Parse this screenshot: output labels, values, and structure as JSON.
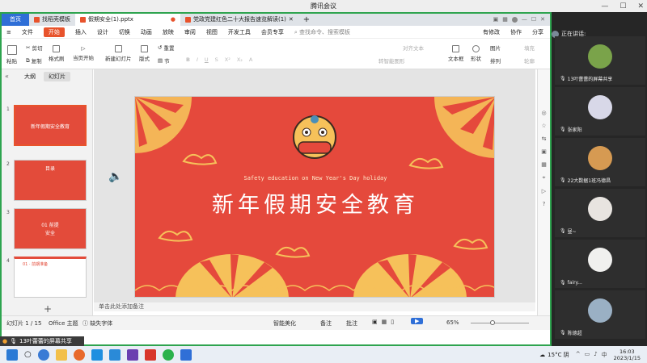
{
  "meeting": {
    "title": "腾讯会议"
  },
  "tabs": [
    {
      "label": "首页"
    },
    {
      "label": "找稻壳模板"
    },
    {
      "label": "假期安全(1).pptx"
    },
    {
      "label": "党政党建红色二十大报告速览解读(1)"
    }
  ],
  "menu": {
    "file": "文件",
    "start": "开始",
    "items": [
      "插入",
      "设计",
      "切换",
      "动画",
      "放映",
      "审阅",
      "视图",
      "开发工具",
      "会员专享"
    ],
    "search": "查找命令、搜索模板",
    "right": [
      "有修改",
      "协作",
      "分享"
    ]
  },
  "toolbar": {
    "paste": "粘贴",
    "cut": "剪切",
    "copy": "复制",
    "format_painter": "格式刷",
    "play": "当页开始",
    "new_slide": "新建幻灯片",
    "layout": "版式",
    "section": "节",
    "reset": "重置",
    "align_text": "对齐文本",
    "smartart": "转智能图形",
    "textbox": "文本框",
    "shape": "形状",
    "picture": "图片",
    "arrange": "排列",
    "fill": "填充",
    "outline": "轮廓"
  },
  "sidebar": {
    "tab_outline": "大纲",
    "tab_slides": "幻灯片",
    "slide_numbers": [
      "1",
      "2",
      "3",
      "4"
    ],
    "thumb2_title": "目录",
    "thumb3_left": "01",
    "thumb3_right": "前提",
    "thumb3_sub": "安全",
    "thumb4_title": "01 · 前期准备"
  },
  "slide": {
    "subtitle": "Safety education on New Year's Day holiday",
    "title": "新年假期安全教育"
  },
  "notes": {
    "placeholder": "单击此处添加备注"
  },
  "status": {
    "slide_info": "幻灯片 1 / 15",
    "theme": "Office 主题",
    "missing_font": "缺失字体",
    "beautify": "智能美化",
    "notes": "备注",
    "comments": "批注",
    "zoom": "65%"
  },
  "participants": {
    "speaking_label": "正在讲话:",
    "list": [
      {
        "name": "13叶蕾蕾的屏幕共享",
        "color": "#7aa34a"
      },
      {
        "name": "张家阳",
        "color": "#d8d8e8"
      },
      {
        "name": "22大数据1班冯德昌",
        "color": "#d69a52"
      },
      {
        "name": "昼~",
        "color": "#e8e4e0"
      },
      {
        "name": "fairy...",
        "color": "#f0f0ee"
      },
      {
        "name": "陈德超",
        "color": "#9ab0c4"
      }
    ]
  },
  "share_bar": {
    "label": "13叶蕾蕾的屏幕共享"
  },
  "taskbar": {
    "weather": "15°C 阴",
    "time": "16:03",
    "date": "2023/1/15"
  }
}
